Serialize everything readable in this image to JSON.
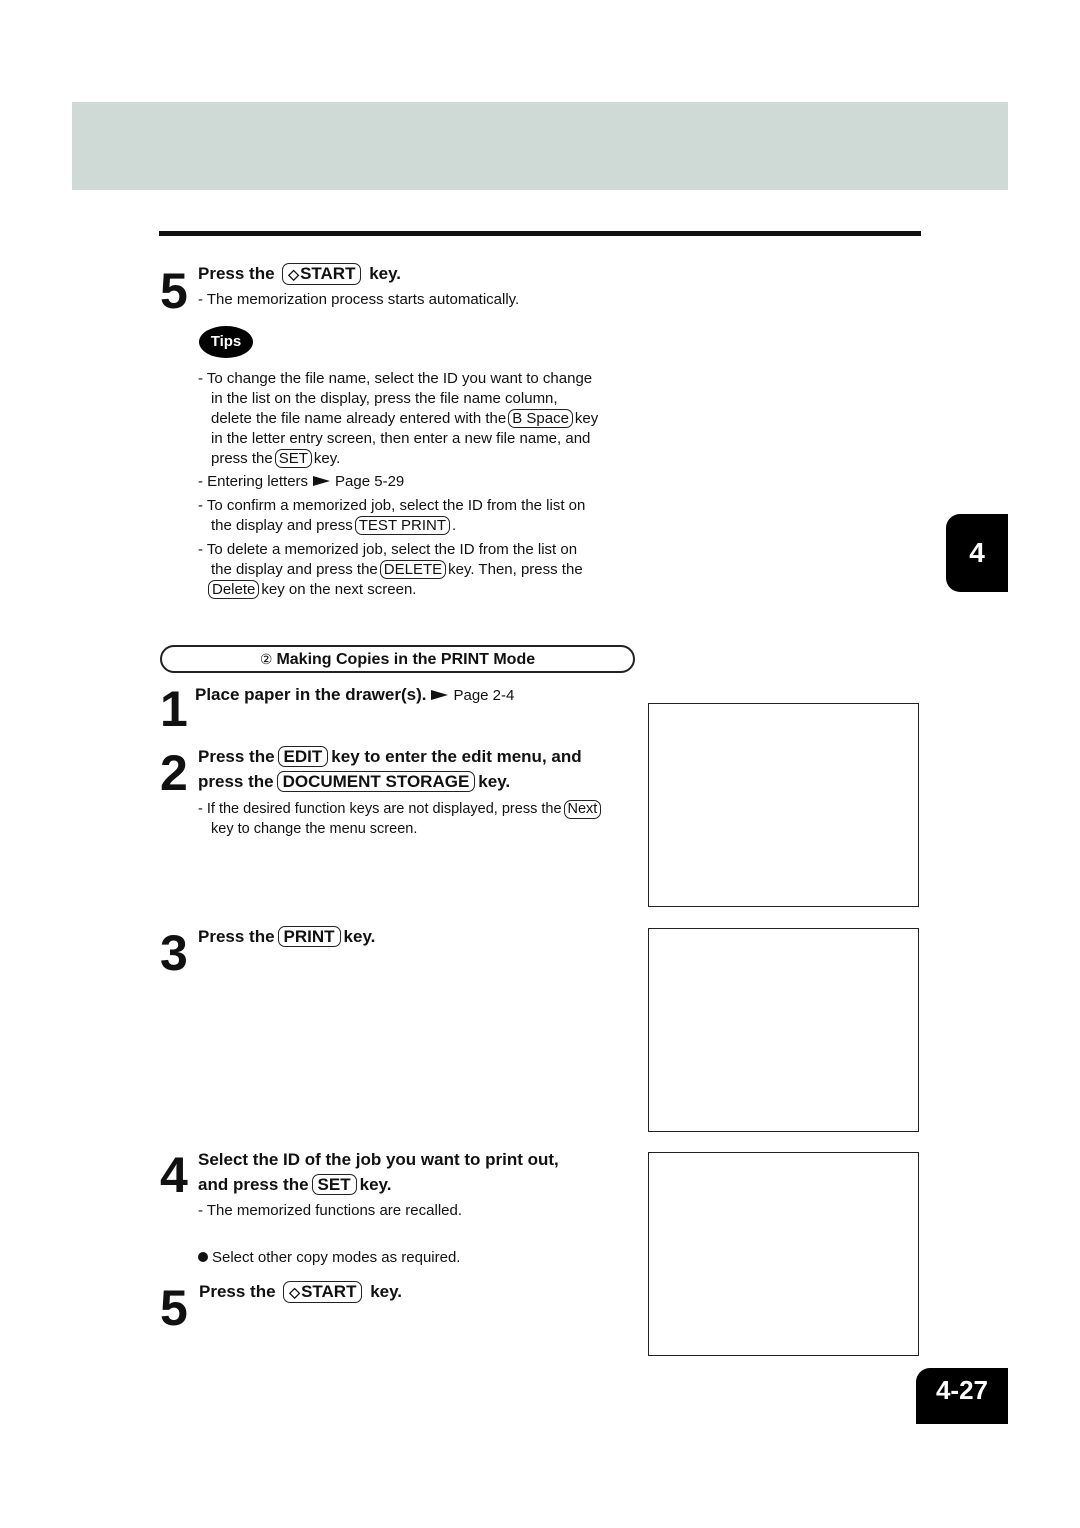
{
  "page": {
    "chapter_tab": "4",
    "page_number": "4-27"
  },
  "step5a": {
    "number": "5",
    "prefix": "Press the",
    "key_glyph": "◇",
    "key": "START",
    "suffix": "key.",
    "note": "- The memorization process starts automatically."
  },
  "tips": {
    "badge": "Tips",
    "items": [
      {
        "l1": "- To change the file name, select the ID you want to change",
        "l2": "in the list on the display, press the file name column,",
        "l3_pre": "delete the file name already entered with the",
        "l3_key": "B Space",
        "l3_post": "key",
        "l4": "in the letter entry screen, then enter a new file name, and",
        "l5_pre": "press the",
        "l5_key": "SET",
        "l5_post": "key."
      },
      {
        "text": "- Entering letters",
        "ref": "Page 5-29"
      },
      {
        "l1": "- To confirm a memorized job, select the ID from the list on",
        "l2_pre": "the display and press",
        "l2_key": "TEST PRINT",
        "l2_post": "."
      },
      {
        "l1": "- To delete a memorized job, select the ID from the list on",
        "l2_pre": "the display and press the",
        "l2_key": "DELETE",
        "l2_post": "key. Then, press the",
        "l3_key": "Delete",
        "l3_post": "key on the next screen."
      }
    ]
  },
  "section": {
    "marker": "②",
    "title": "Making Copies in the PRINT Mode"
  },
  "step1": {
    "number": "1",
    "text": "Place paper in the drawer(s).",
    "ref": "Page 2-4"
  },
  "step2": {
    "number": "2",
    "l1_pre": "Press the",
    "l1_key": "EDIT",
    "l1_post": "key to enter the edit menu, and",
    "l2_pre": "press the",
    "l2_key": "DOCUMENT STORAGE",
    "l2_post": "key.",
    "note_pre": "- If the desired function keys are not displayed, press the",
    "note_key": "Next",
    "note_l2": "key to change the menu screen."
  },
  "step3": {
    "number": "3",
    "prefix": "Press the",
    "key": "PRINT",
    "suffix": "key."
  },
  "step4": {
    "number": "4",
    "l1": "Select the ID of the job you want to print out,",
    "l2_pre": "and press the",
    "l2_key": "SET",
    "l2_post": "key.",
    "note": "- The memorized functions are recalled.",
    "bullet": "Select other copy modes as required."
  },
  "step5b": {
    "number": "5",
    "prefix": "Press the",
    "key_glyph": "◇",
    "key": "START",
    "suffix": "key."
  }
}
